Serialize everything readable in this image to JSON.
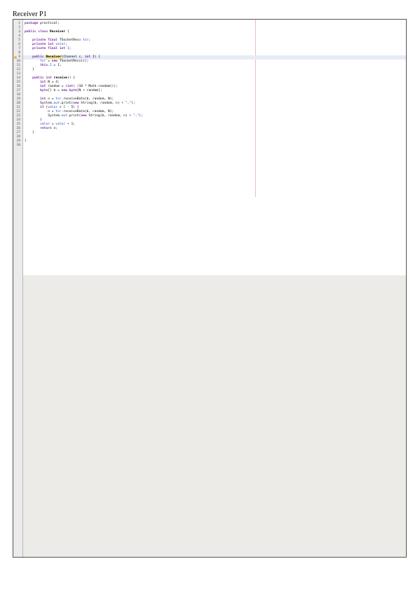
{
  "document": {
    "title": "Receiver P1"
  },
  "editor": {
    "lines": [
      {
        "n": "1",
        "segs": [
          [
            "kw",
            "package"
          ],
          [
            "plain",
            " practical;"
          ]
        ]
      },
      {
        "n": "2",
        "segs": []
      },
      {
        "n": "3",
        "segs": [
          [
            "kw",
            "public"
          ],
          [
            "plain",
            " "
          ],
          [
            "kw",
            "class"
          ],
          [
            "plain",
            " "
          ],
          [
            "bold",
            "Receiver"
          ],
          [
            "plain",
            " {"
          ]
        ]
      },
      {
        "n": "4",
        "segs": []
      },
      {
        "n": "5",
        "segs": [
          [
            "plain",
            "    "
          ],
          [
            "kw",
            "private"
          ],
          [
            "plain",
            " "
          ],
          [
            "kw",
            "final"
          ],
          [
            "plain",
            " TSocketRecv "
          ],
          [
            "field",
            "tsr"
          ],
          [
            "plain",
            ";"
          ]
        ]
      },
      {
        "n": "6",
        "segs": [
          [
            "plain",
            "    "
          ],
          [
            "kw",
            "private"
          ],
          [
            "plain",
            " "
          ],
          [
            "kw",
            "int"
          ],
          [
            "plain",
            " "
          ],
          [
            "field",
            "valor"
          ],
          [
            "plain",
            ";"
          ]
        ]
      },
      {
        "n": "7",
        "segs": [
          [
            "plain",
            "    "
          ],
          [
            "kw",
            "private"
          ],
          [
            "plain",
            " "
          ],
          [
            "kw",
            "final"
          ],
          [
            "plain",
            " "
          ],
          [
            "kw",
            "int"
          ],
          [
            "plain",
            " "
          ],
          [
            "field",
            "I"
          ],
          [
            "plain",
            ";"
          ]
        ]
      },
      {
        "n": "8",
        "segs": []
      },
      {
        "n": "9",
        "segs": [
          [
            "plain",
            "    "
          ],
          [
            "kw",
            "public"
          ],
          [
            "plain",
            " "
          ],
          [
            "ctor",
            "Receiver"
          ],
          [
            "plain",
            "(Channel c, "
          ],
          [
            "kw",
            "int"
          ],
          [
            "plain",
            " I) {"
          ]
        ],
        "hl": true,
        "marker": true
      },
      {
        "n": "10",
        "segs": [
          [
            "plain",
            "        "
          ],
          [
            "field",
            "tsr"
          ],
          [
            "plain",
            " = "
          ],
          [
            "kw",
            "new"
          ],
          [
            "plain",
            " TSocketRecv(c);"
          ]
        ]
      },
      {
        "n": "11",
        "segs": [
          [
            "plain",
            "        "
          ],
          [
            "kw",
            "this"
          ],
          [
            "plain",
            "."
          ],
          [
            "field",
            "I"
          ],
          [
            "plain",
            " = I;"
          ]
        ]
      },
      {
        "n": "12",
        "segs": [
          [
            "plain",
            "    }"
          ]
        ]
      },
      {
        "n": "13",
        "segs": []
      },
      {
        "n": "14",
        "segs": [
          [
            "plain",
            "    "
          ],
          [
            "kw",
            "public"
          ],
          [
            "plain",
            " "
          ],
          [
            "kw",
            "int"
          ],
          [
            "plain",
            " "
          ],
          [
            "bold",
            "receive"
          ],
          [
            "plain",
            "() {"
          ]
        ]
      },
      {
        "n": "15",
        "segs": [
          [
            "plain",
            "        "
          ],
          [
            "kw",
            "int"
          ],
          [
            "plain",
            " N = 4;"
          ]
        ]
      },
      {
        "n": "16",
        "segs": [
          [
            "plain",
            "        "
          ],
          [
            "kw",
            "int"
          ],
          [
            "plain",
            " random = ("
          ],
          [
            "kw",
            "int"
          ],
          [
            "plain",
            ") (10 * Math."
          ],
          [
            "italic",
            "random"
          ],
          [
            "plain",
            "());"
          ]
        ]
      },
      {
        "n": "17",
        "segs": [
          [
            "plain",
            "        "
          ],
          [
            "kw",
            "byte"
          ],
          [
            "plain",
            "[] b = "
          ],
          [
            "kw",
            "new"
          ],
          [
            "plain",
            " "
          ],
          [
            "kw",
            "byte"
          ],
          [
            "plain",
            "[N + random];"
          ]
        ]
      },
      {
        "n": "18",
        "segs": []
      },
      {
        "n": "19",
        "segs": [
          [
            "plain",
            "        "
          ],
          [
            "kw",
            "int"
          ],
          [
            "plain",
            " n = "
          ],
          [
            "field",
            "tsr"
          ],
          [
            "plain",
            ".receiveData(b, random, N);"
          ]
        ]
      },
      {
        "n": "20",
        "segs": [
          [
            "plain",
            "        System."
          ],
          [
            "field",
            "out"
          ],
          [
            "plain",
            ".print("
          ],
          [
            "kw",
            "new"
          ],
          [
            "plain",
            " String(b, random, n) + "
          ],
          [
            "str",
            "\",\""
          ],
          [
            "plain",
            ");"
          ]
        ]
      },
      {
        "n": "21",
        "segs": [
          [
            "plain",
            "        "
          ],
          [
            "kw",
            "if"
          ],
          [
            "plain",
            " ("
          ],
          [
            "field",
            "valor"
          ],
          [
            "plain",
            " > "
          ],
          [
            "field",
            "I"
          ],
          [
            "plain",
            " - 5) {"
          ]
        ]
      },
      {
        "n": "22",
        "segs": [
          [
            "plain",
            "            n = "
          ],
          [
            "field",
            "tsr"
          ],
          [
            "plain",
            ".receiveData(b, random, N);"
          ]
        ]
      },
      {
        "n": "23",
        "segs": [
          [
            "plain",
            "            System."
          ],
          [
            "field",
            "out"
          ],
          [
            "plain",
            ".print("
          ],
          [
            "kw",
            "new"
          ],
          [
            "plain",
            " String(b, random, n) + "
          ],
          [
            "str",
            "\",\""
          ],
          [
            "plain",
            ");"
          ]
        ]
      },
      {
        "n": "24",
        "segs": [
          [
            "plain",
            "        }"
          ]
        ]
      },
      {
        "n": "25",
        "segs": [
          [
            "plain",
            "        "
          ],
          [
            "field",
            "valor"
          ],
          [
            "plain",
            " = "
          ],
          [
            "field",
            "valor"
          ],
          [
            "plain",
            " + 1;"
          ]
        ]
      },
      {
        "n": "26",
        "segs": [
          [
            "plain",
            "        "
          ],
          [
            "kw",
            "return"
          ],
          [
            "plain",
            " n;"
          ]
        ]
      },
      {
        "n": "27",
        "segs": [
          [
            "plain",
            "    }"
          ]
        ]
      },
      {
        "n": "28",
        "segs": []
      },
      {
        "n": "29",
        "segs": [
          [
            "plain",
            "}"
          ]
        ]
      },
      {
        "n": "30",
        "segs": []
      }
    ]
  }
}
